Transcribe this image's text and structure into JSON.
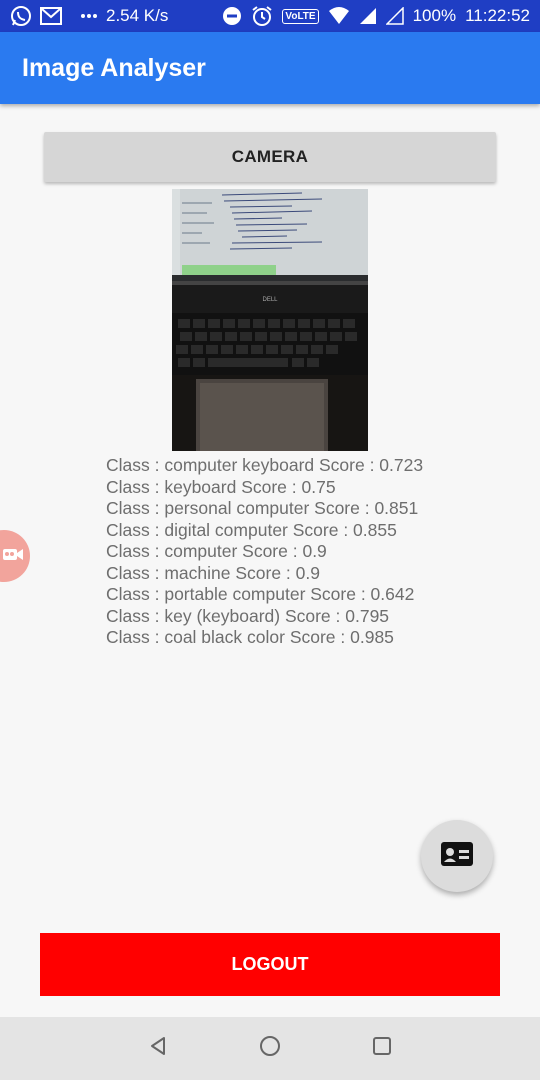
{
  "status_bar": {
    "net_speed": "2.54 K/s",
    "volte_label": "VoLTE",
    "battery": "100%",
    "time": "11:22:52",
    "icons": [
      "whatsapp-icon",
      "gmail-icon",
      "more-dots-icon",
      "dnd-icon",
      "alarm-icon",
      "volte-icon",
      "wifi-icon",
      "signal-icon",
      "signal-empty-icon"
    ]
  },
  "app_bar": {
    "title": "Image Analyser"
  },
  "camera_button": {
    "label": "CAMERA"
  },
  "photo": {
    "alt": "photo of a laptop keyboard",
    "brand_label": "DELL"
  },
  "results": [
    "Class : computer keyboard Score : 0.723",
    "Class : keyboard Score : 0.75",
    "Class : personal computer Score : 0.851",
    "Class : digital computer Score : 0.855",
    "Class : computer Score : 0.9",
    "Class : machine Score : 0.9",
    "Class : portable computer Score : 0.642",
    "Class : key (keyboard) Score : 0.795",
    "Class : coal black color Score : 0.985"
  ],
  "floating_camera": {
    "icon": "video-camera-icon"
  },
  "fab": {
    "icon": "id-card-icon"
  },
  "logout_button": {
    "label": "LOGOUT"
  },
  "nav_bar": {
    "icons": [
      "back-icon",
      "home-icon",
      "recents-icon"
    ]
  },
  "colors": {
    "status_bar": "#1f3ec4",
    "app_bar": "#2a7af0",
    "logout": "#ff0000",
    "text": "#6e6e6e"
  }
}
